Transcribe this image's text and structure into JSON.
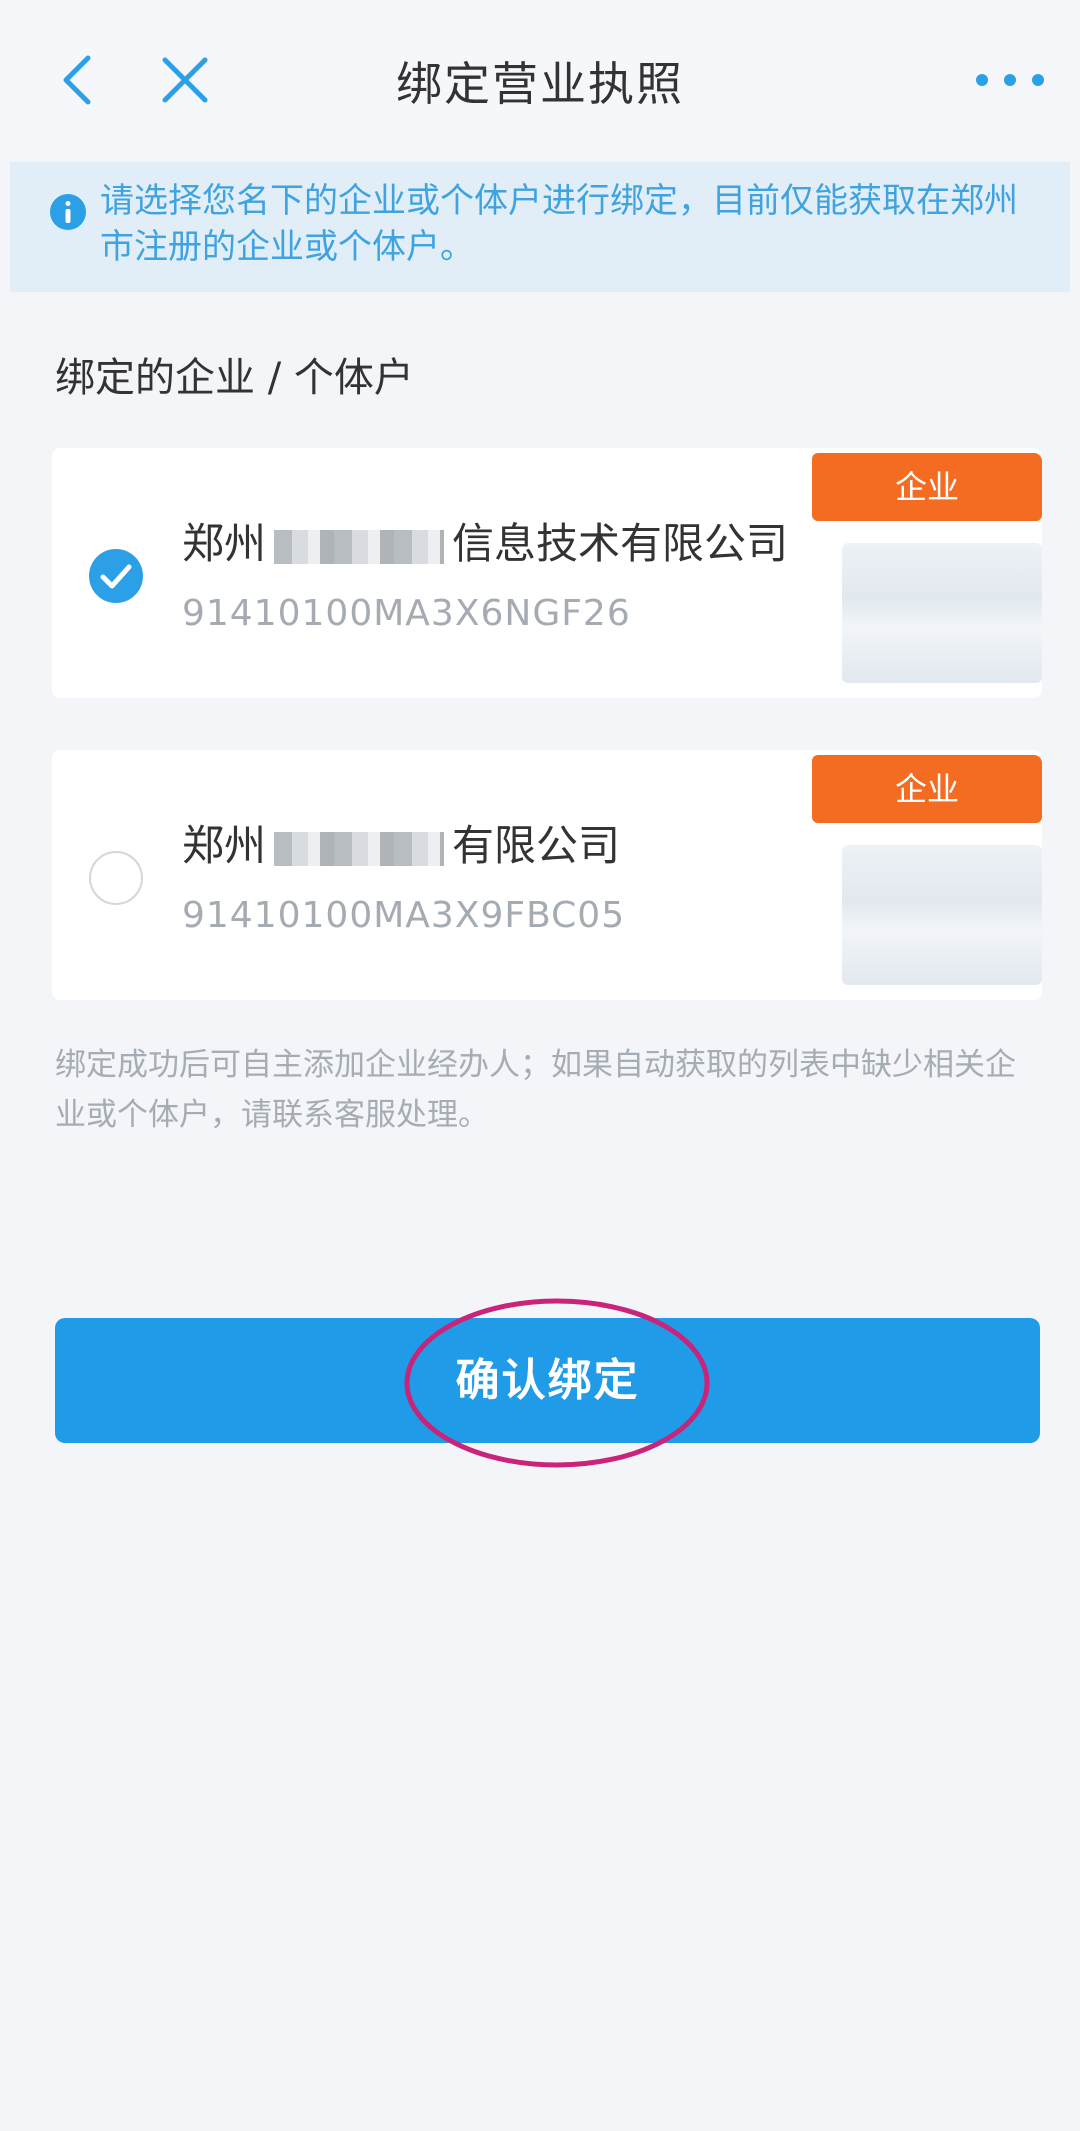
{
  "header": {
    "title": "绑定营业执照"
  },
  "notice": {
    "text": "请选择您名下的企业或个体户进行绑定，目前仅能获取在郑州市注册的企业或个体户。"
  },
  "section": {
    "title": "绑定的企业 / 个体户"
  },
  "companies": [
    {
      "name_prefix": "郑州",
      "name_suffix": "信息技术有限公司",
      "code": "91410100MA3X6NGF26",
      "badge": "企业",
      "selected": true
    },
    {
      "name_prefix": "郑州",
      "name_suffix": "有限公司",
      "code": "91410100MA3X9FBC05",
      "badge": "企业",
      "selected": false
    }
  ],
  "tip": {
    "text": "绑定成功后可自主添加企业经办人；如果自动获取的列表中缺少相关企业或个体户，请联系客服处理。"
  },
  "confirm_button": {
    "label": "确认绑定"
  },
  "colors": {
    "primary": "#1f9be8",
    "badge": "#f36c21",
    "notice_text": "#3fa3df",
    "annotation": "#c9237a"
  }
}
